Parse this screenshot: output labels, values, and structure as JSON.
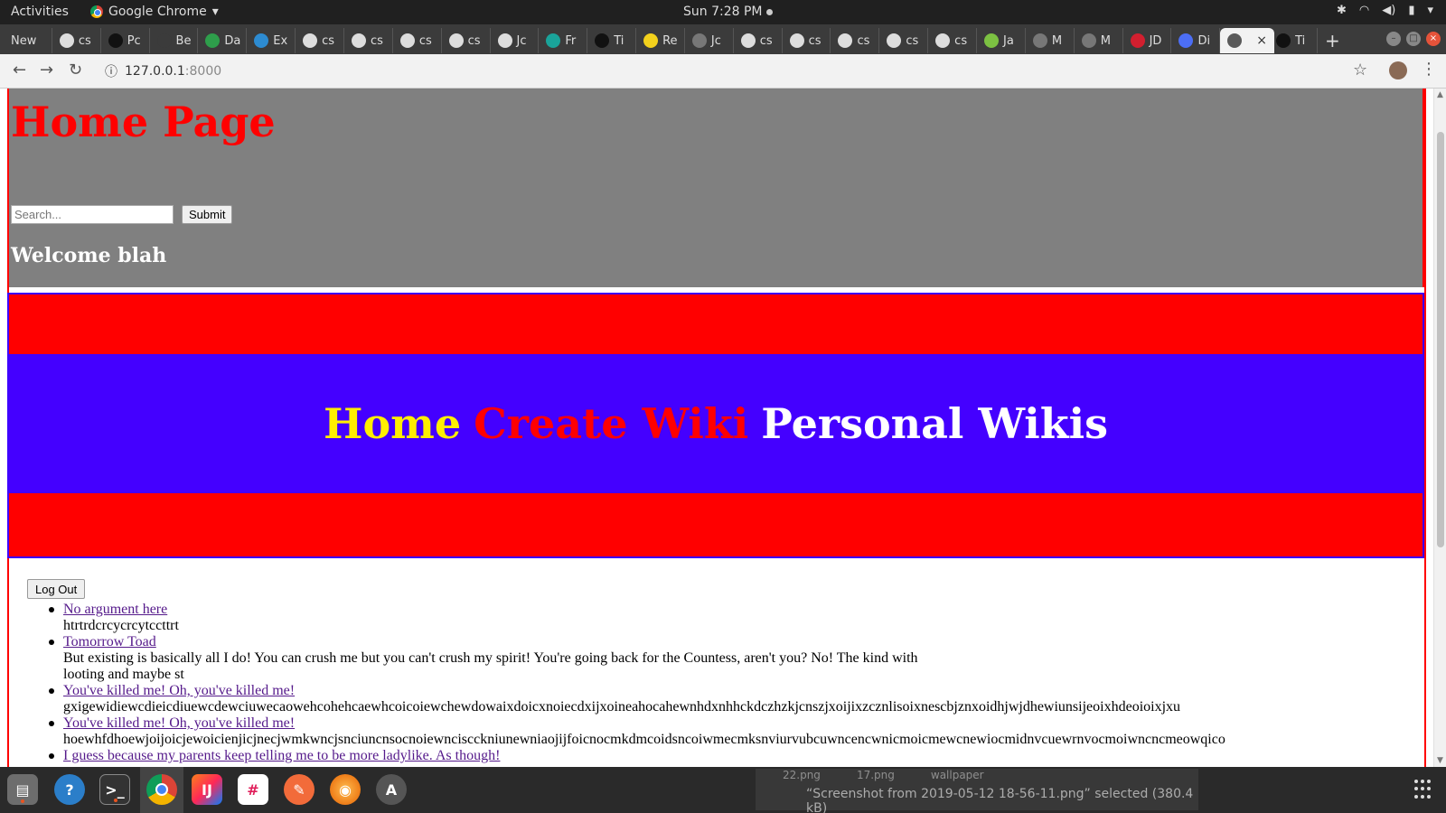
{
  "topbar": {
    "activities": "Activities",
    "app_name": "Google Chrome",
    "clock": "Sun  7:28 PM"
  },
  "tabs": [
    {
      "label": "New",
      "color": "#3b3b3b"
    },
    {
      "label": "cs",
      "color": "#dddddd"
    },
    {
      "label": "Pc",
      "color": "#111111"
    },
    {
      "label": "Be",
      "color": "#3b3b3b"
    },
    {
      "label": "Da",
      "color": "#2e9e4b"
    },
    {
      "label": "Ex",
      "color": "#2d8bd1"
    },
    {
      "label": "cs",
      "color": "#dddddd"
    },
    {
      "label": "cs",
      "color": "#dddddd"
    },
    {
      "label": "cs",
      "color": "#dddddd"
    },
    {
      "label": "cs",
      "color": "#dddddd"
    },
    {
      "label": "Jc",
      "color": "#dddddd"
    },
    {
      "label": "Fr",
      "color": "#1aa39a"
    },
    {
      "label": "Ti",
      "color": "#111111"
    },
    {
      "label": "Re",
      "color": "#f3d11c"
    },
    {
      "label": "Jc",
      "color": "#777777"
    },
    {
      "label": "cs",
      "color": "#dddddd"
    },
    {
      "label": "cs",
      "color": "#dddddd"
    },
    {
      "label": "cs",
      "color": "#dddddd"
    },
    {
      "label": "cs",
      "color": "#dddddd"
    },
    {
      "label": "cs",
      "color": "#dddddd"
    },
    {
      "label": "Ja",
      "color": "#7cc142"
    },
    {
      "label": "M",
      "color": "#777777"
    },
    {
      "label": "M",
      "color": "#777777"
    },
    {
      "label": "JD",
      "color": "#d21f2f"
    },
    {
      "label": "Di",
      "color": "#4c6ef5"
    },
    {
      "label": "",
      "color": "#5a5a5a",
      "active": true
    },
    {
      "label": "Ti",
      "color": "#111111"
    }
  ],
  "address": {
    "host": "127.0.0.1",
    "port": ":8000"
  },
  "page": {
    "title": "Home Page",
    "search_placeholder": "Search...",
    "submit_label": "Submit",
    "welcome": "Welcome blah",
    "nav": {
      "home": "Home",
      "create": "Create Wiki",
      "personal": "Personal Wikis"
    },
    "logout_label": "Log Out",
    "wikis": [
      {
        "title": "No argument here",
        "body": "htrtrdcrcycrcytccttrt"
      },
      {
        "title": "Tomorrow Toad",
        "body": "But existing is basically all I do! You can crush me but you can't crush my spirit! You're going back for the Countess, aren't you? No! The kind with",
        "body2": "looting and maybe st"
      },
      {
        "title": "You've killed me! Oh, you've killed me!",
        "body": "gxigewidiewcdieicdiuewcdewciuwecaowehcohehcaewhcoicoiewchewdowaixdoicxnoiecdxijxoineahocahewnhdxnhhckdczhzkjcnszjxoijixzcznlisoixnescbjznxoidhjwjdhewiunsijeoixhdeoioixjxu"
      },
      {
        "title": "You've killed me! Oh, you've killed me!",
        "body": "hoewhfdhoewjoijoicjewoicienjicjnecjwmkwncjsnciuncnsocnoiewnciscckniunewniaojijfoicnocmkdmcoidsncoiwmecmksnviurvubcuwncencwnicmoicmewcnewiocmidnvcuewrnvocmoiwncncmeowqico"
      },
      {
        "title": "I guess because my parents keep telling me to be more ladylike. As though!",
        "body": ""
      }
    ]
  },
  "dock_ghost": {
    "files": [
      "22.png",
      "17.png",
      "wallpaper"
    ],
    "status": "“Screenshot from 2019-05-12 18-56-11.png” selected  (380.4 kB)"
  },
  "colors": {
    "page_title": "#ff0000",
    "header_bg": "#808080",
    "nav_outer": "#ff0000",
    "nav_inner": "#4400ff",
    "nav_home": "#ffee00",
    "nav_create": "#ff0000",
    "nav_personal": "#ffffff",
    "link": "#551a8b"
  }
}
